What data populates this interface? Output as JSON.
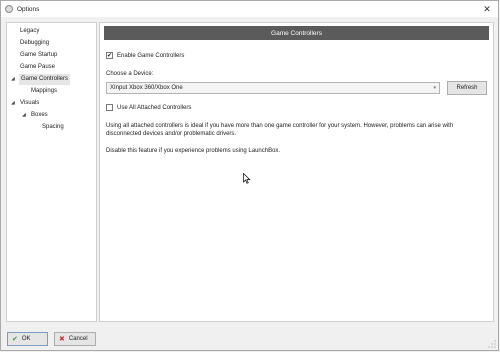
{
  "window": {
    "title": "Options",
    "close_glyph": "✕"
  },
  "sidebar": {
    "items": [
      {
        "label": "Legacy",
        "arrow": ""
      },
      {
        "label": "Debugging",
        "arrow": ""
      },
      {
        "label": "Game Startup",
        "arrow": ""
      },
      {
        "label": "Game Pause",
        "arrow": ""
      },
      {
        "label": "Game Controllers",
        "arrow": "◢",
        "selected": true
      },
      {
        "label": "Mappings",
        "arrow": ""
      },
      {
        "label": "Visuals",
        "arrow": "◢"
      },
      {
        "label": "Boxes",
        "arrow": "◢"
      },
      {
        "label": "Spacing",
        "arrow": ""
      }
    ]
  },
  "content": {
    "header": "Game Controllers",
    "enable_checkbox": {
      "label": "Enable Game Controllers",
      "checked": true,
      "mark": "✔"
    },
    "device_label": "Choose a Device:",
    "device_select": {
      "value": "XInput Xbox 360/Xbox One",
      "arrow": "▾"
    },
    "refresh_label": "Refresh",
    "use_all_checkbox": {
      "label": "Use All Attached Controllers",
      "checked": false,
      "mark": ""
    },
    "description": "Using all attached controllers is ideal if you have more than one game controller for your system. However, problems can arise with disconnected devices and/or problematic drivers.",
    "disable_note": "Disable this feature if you experience problems using LaunchBox."
  },
  "footer": {
    "ok_label": "OK",
    "ok_icon": "✔",
    "cancel_label": "Cancel",
    "cancel_icon": "✖"
  },
  "colors": {
    "header_bg": "#5b5b5b",
    "ok_icon": "#3a9a3a",
    "cancel_icon": "#c23a3a",
    "selected_bg": "#e6e6e6"
  }
}
